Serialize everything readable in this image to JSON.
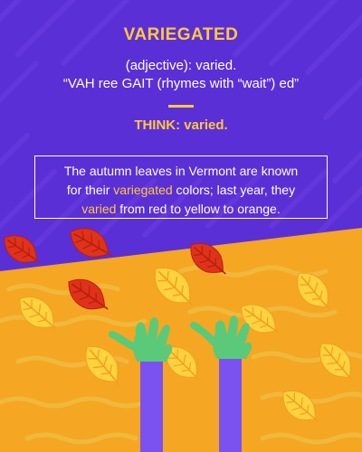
{
  "vocab": {
    "word": "VARIEGATED",
    "part_of_speech": "(adjective): varied.",
    "pronunciation": "“VAH ree GAIT (rhymes with “wait”) ed”",
    "think": "THINK: varied.",
    "example": {
      "line1_pre": "The autumn leaves in Vermont are known",
      "line2_pre": "for their ",
      "line2_highlight": "variegated",
      "line2_post": " colors; last year, they",
      "line3_highlight": "varied",
      "line3_post": " from red to yellow to orange."
    }
  },
  "colors": {
    "background_purple": "#5b2fd6",
    "accent_yellow": "#ffc83d",
    "ground_orange": "#f5a623",
    "arm_purple": "#7b52ef",
    "hand_green": "#5ac97a",
    "leaf_red": "#e0321a",
    "leaf_yellow": "#ffd23f"
  }
}
